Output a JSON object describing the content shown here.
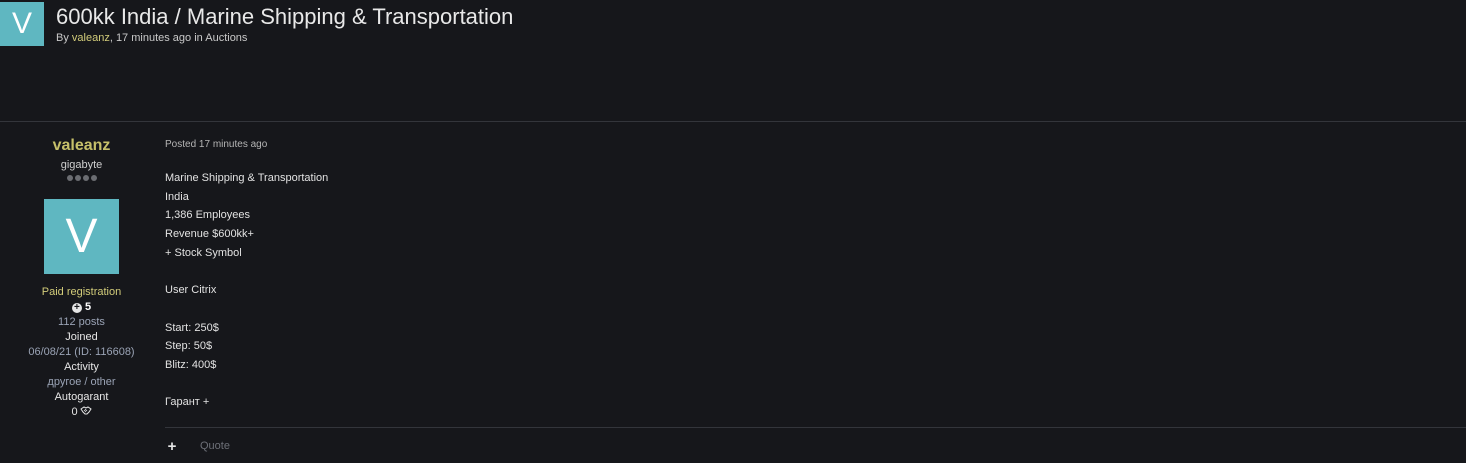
{
  "topic": {
    "avatar_letter": "V",
    "title": "600kk India / Marine Shipping & Transportation",
    "meta": {
      "by_prefix": "By ",
      "author": "valeanz",
      "time_text": ", 17 minutes ago in ",
      "forum": "Auctions"
    }
  },
  "author": {
    "name": "valeanz",
    "group": "gigabyte",
    "rank_dots": 4,
    "avatar_letter": "V",
    "paid_registration": "Paid registration",
    "reputation": "5",
    "posts": "112 posts",
    "joined_label": "Joined",
    "joined_value": "06/08/21 (ID: 116608)",
    "activity_label": "Activity",
    "activity_value": "другое / other",
    "autogarant_label": "Autogarant",
    "autogarant_value": "0"
  },
  "post": {
    "posted": "Posted 17 minutes ago",
    "lines": [
      "Marine Shipping & Transportation",
      "India",
      "1,386 Employees",
      "Revenue $600kk+",
      "+ Stock Symbol",
      "",
      "User Citrix",
      "",
      "Start: 250$",
      "Step: 50$",
      "Blitz: 400$",
      "",
      "Гарант +"
    ],
    "plus_label": "+",
    "quote_label": "Quote"
  },
  "colors": {
    "background": "#16171b",
    "avatar": "#5fb7c1",
    "author_name": "#c6c06a",
    "link": "#d2cc7a",
    "muted_blue": "#9aa3b5"
  }
}
